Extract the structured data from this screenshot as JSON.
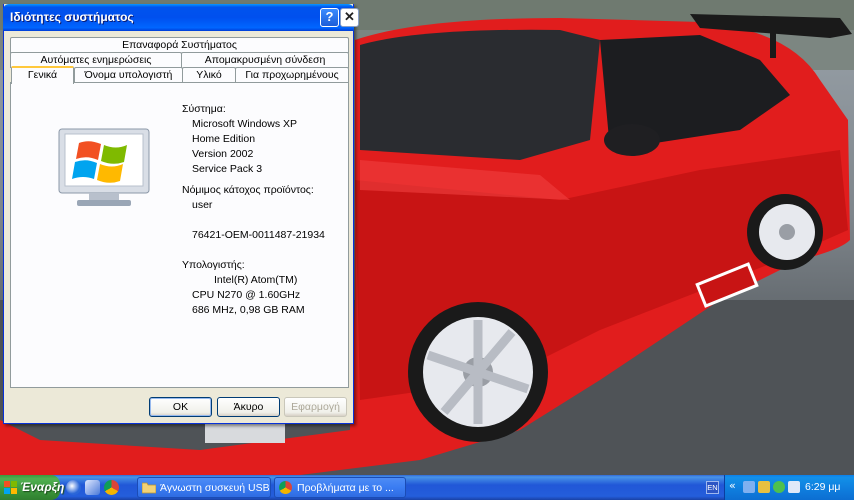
{
  "window": {
    "title": "Ιδιότητες συστήματος",
    "help_label": "?",
    "close_label": "✕",
    "tabs_row1": [
      "Επαναφορά Συστήματος"
    ],
    "tabs_row2": [
      "Αυτόματες ενημερώσεις",
      "Απομακρυσμένη σύνδεση"
    ],
    "tabs_row3": [
      "Γενικά",
      "Όνομα υπολογιστή",
      "Υλικό",
      "Για προχωρημένους"
    ],
    "active_tab": "Γενικά"
  },
  "general": {
    "system_heading": "Σύστημα:",
    "os_name": "Microsoft Windows XP",
    "edition": "Home Edition",
    "version": "Version 2002",
    "service_pack": "Service Pack 3",
    "owner_heading": "Νόμιμος κάτοχος προϊόντος:",
    "owner": "user",
    "product_id": "76421-OEM-0011487-21934",
    "computer_heading": "Υπολογιστής:",
    "cpu_name": "Intel(R) Atom(TM)",
    "cpu_model": "CPU N270   @ 1.60GHz",
    "cpu_ram": "686 MHz, 0,98 GB RAM",
    "logo_icon": "windows-xp-monitor-icon"
  },
  "buttons": {
    "ok": "OK",
    "cancel": "Άκυρο",
    "apply": "Εφαρμογή"
  },
  "taskbar": {
    "start_label": "Έναρξη",
    "quick_launch": [
      "media-player-icon",
      "show-desktop-icon",
      "chrome-icon"
    ],
    "tasks": [
      {
        "label": "Άγνωστη συσκευή USB",
        "icon": "folder-icon"
      },
      {
        "label": "Προβλήματα με το ...",
        "icon": "chrome-icon"
      }
    ],
    "language": "EN",
    "clock": "6:29 μμ"
  },
  "colors": {
    "titlebar": "#0054e3",
    "window_bg": "#ece9d8",
    "taskbar": "#245edb",
    "start": "#3b963b",
    "active_tab_highlight": "#ffc83c"
  }
}
